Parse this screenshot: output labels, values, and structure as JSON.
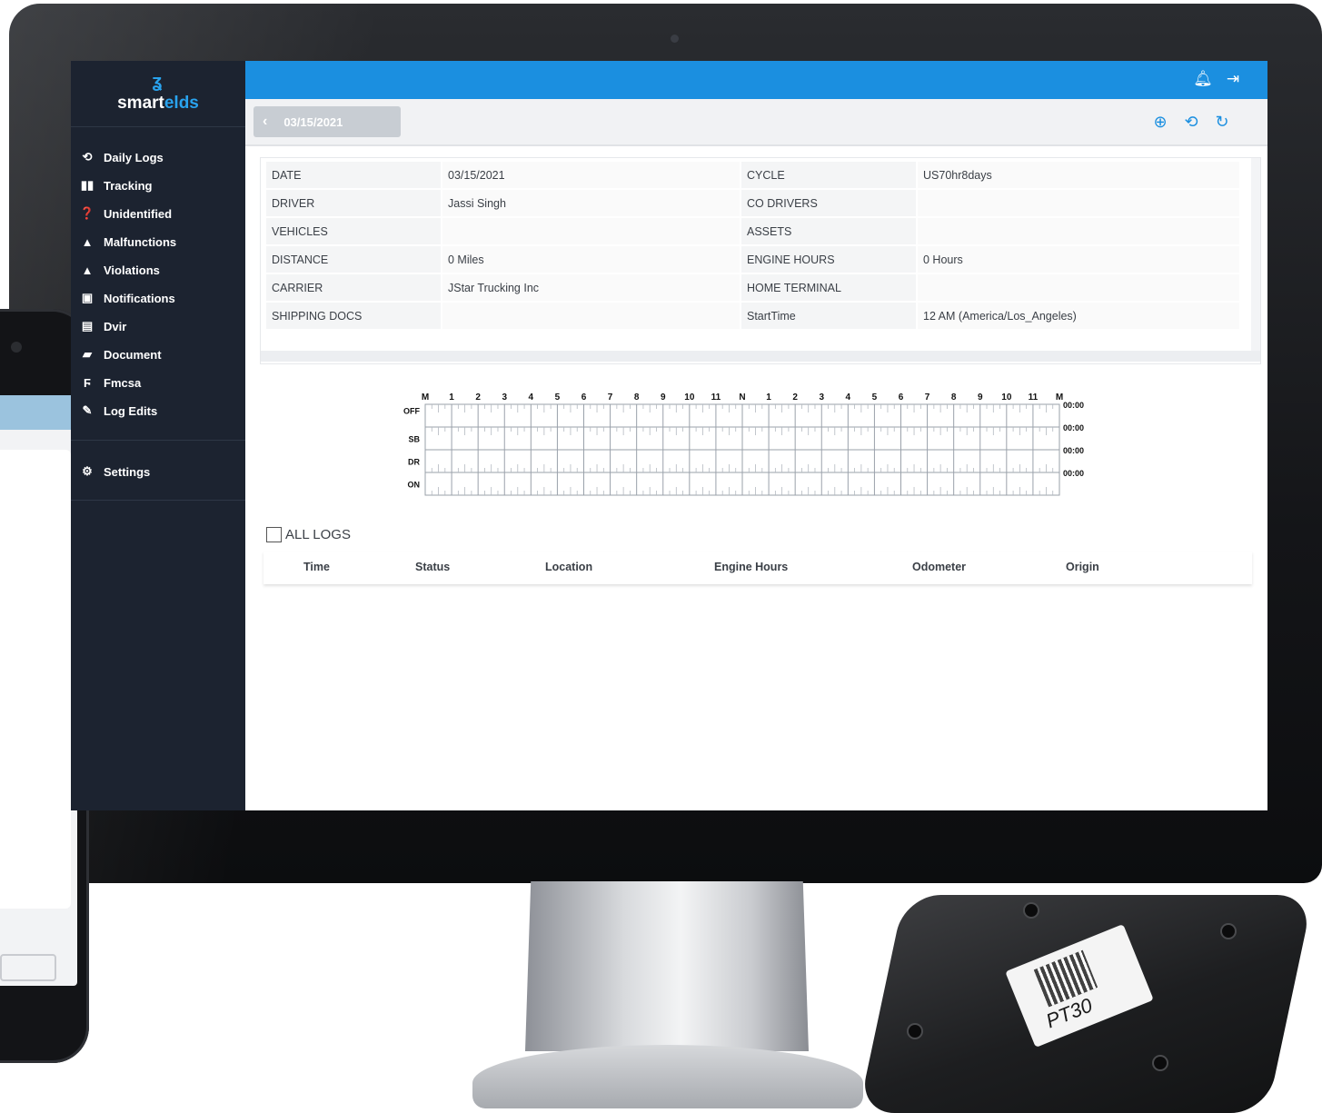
{
  "brand": {
    "prefix": "smart",
    "suffix": "elds",
    "logo_icon": "ʓ"
  },
  "sidebar": {
    "items": [
      {
        "label": "Daily Logs",
        "icon": "history-icon"
      },
      {
        "label": "Tracking",
        "icon": "tracking-icon"
      },
      {
        "label": "Unidentified",
        "icon": "question-icon"
      },
      {
        "label": "Malfunctions",
        "icon": "warning-icon"
      },
      {
        "label": "Violations",
        "icon": "warning-icon"
      },
      {
        "label": "Notifications",
        "icon": "message-icon"
      },
      {
        "label": "Dvir",
        "icon": "truck-icon"
      },
      {
        "label": "Document",
        "icon": "document-icon"
      },
      {
        "label": "Fmcsa",
        "icon": "file-icon"
      },
      {
        "label": "Log Edits",
        "icon": "pencil-icon"
      }
    ],
    "settings_label": "Settings"
  },
  "toolbar": {
    "date": "03/15/2021"
  },
  "info": {
    "rows": [
      {
        "l1": "DATE",
        "v1": "03/15/2021",
        "l2": "CYCLE",
        "v2": "US70hr8days"
      },
      {
        "l1": "DRIVER",
        "v1": "Jassi Singh",
        "l2": "CO DRIVERS",
        "v2": ""
      },
      {
        "l1": "VEHICLES",
        "v1": "",
        "l2": "ASSETS",
        "v2": ""
      },
      {
        "l1": "DISTANCE",
        "v1": "0 Miles",
        "l2": "ENGINE HOURS",
        "v2": "0 Hours"
      },
      {
        "l1": "CARRIER",
        "v1": "JStar Trucking Inc",
        "l2": "HOME TERMINAL",
        "v2": ""
      },
      {
        "l1": "SHIPPING DOCS",
        "v1": "",
        "l2": "StartTime",
        "v2": "12 AM (America/Los_Angeles)"
      }
    ]
  },
  "graph": {
    "hour_labels": [
      "M",
      "1",
      "2",
      "3",
      "4",
      "5",
      "6",
      "7",
      "8",
      "9",
      "10",
      "11",
      "N",
      "1",
      "2",
      "3",
      "4",
      "5",
      "6",
      "7",
      "8",
      "9",
      "10",
      "11",
      "M"
    ],
    "rows": [
      "OFF",
      "SB",
      "DR",
      "ON"
    ],
    "totals": [
      "00:00",
      "00:00",
      "00:00",
      "00:00"
    ]
  },
  "logs": {
    "all_logs_label": "ALL LOGS",
    "columns": [
      "Time",
      "Status",
      "Location",
      "Engine Hours",
      "Odometer",
      "Origin"
    ]
  },
  "device": {
    "label": "PT30"
  },
  "colors": {
    "sidebar": "#1c2330",
    "topbar": "#1b8fe0",
    "accent": "#29a3ee"
  }
}
